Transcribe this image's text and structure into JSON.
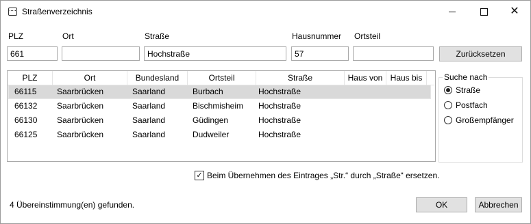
{
  "window": {
    "title": "Straßenverzeichnis",
    "minimize": "–",
    "maximize": "□",
    "close": "✕"
  },
  "form": {
    "plz_label": "PLZ",
    "plz_value": "661",
    "ort_label": "Ort",
    "ort_value": "",
    "strasse_label": "Straße",
    "strasse_value": "Hochstraße",
    "hausnummer_label": "Hausnummer",
    "hausnummer_value": "57",
    "ortsteil_label": "Ortsteil",
    "ortsteil_value": "",
    "reset_label": "Zurücksetzen"
  },
  "table": {
    "columns": [
      "PLZ",
      "Ort",
      "Bundesland",
      "Ortsteil",
      "Straße",
      "Haus von",
      "Haus bis"
    ],
    "rows": [
      {
        "plz": "66115",
        "ort": "Saarbrücken",
        "bundesland": "Saarland",
        "ortsteil": "Burbach",
        "strasse": "Hochstraße",
        "haus_von": "",
        "haus_bis": "",
        "selected": true
      },
      {
        "plz": "66132",
        "ort": "Saarbrücken",
        "bundesland": "Saarland",
        "ortsteil": "Bischmisheim",
        "strasse": "Hochstraße",
        "haus_von": "",
        "haus_bis": ""
      },
      {
        "plz": "66130",
        "ort": "Saarbrücken",
        "bundesland": "Saarland",
        "ortsteil": "Güdingen",
        "strasse": "Hochstraße",
        "haus_von": "",
        "haus_bis": ""
      },
      {
        "plz": "66125",
        "ort": "Saarbrücken",
        "bundesland": "Saarland",
        "ortsteil": "Dudweiler",
        "strasse": "Hochstraße",
        "haus_von": "",
        "haus_bis": ""
      }
    ]
  },
  "search_by": {
    "title": "Suche nach",
    "options": [
      {
        "label": "Straße",
        "checked": true
      },
      {
        "label": "Postfach",
        "checked": false
      },
      {
        "label": "Großempfänger",
        "checked": false
      }
    ]
  },
  "replace_checkbox": {
    "label": "Beim Übernehmen des Eintrages „Str.“ durch „Straße“ ersetzen.",
    "checked": true,
    "mark": "✓"
  },
  "status": "4 Übereinstimmung(en) gefunden.",
  "buttons": {
    "ok": "OK",
    "cancel": "Abbrechen"
  }
}
